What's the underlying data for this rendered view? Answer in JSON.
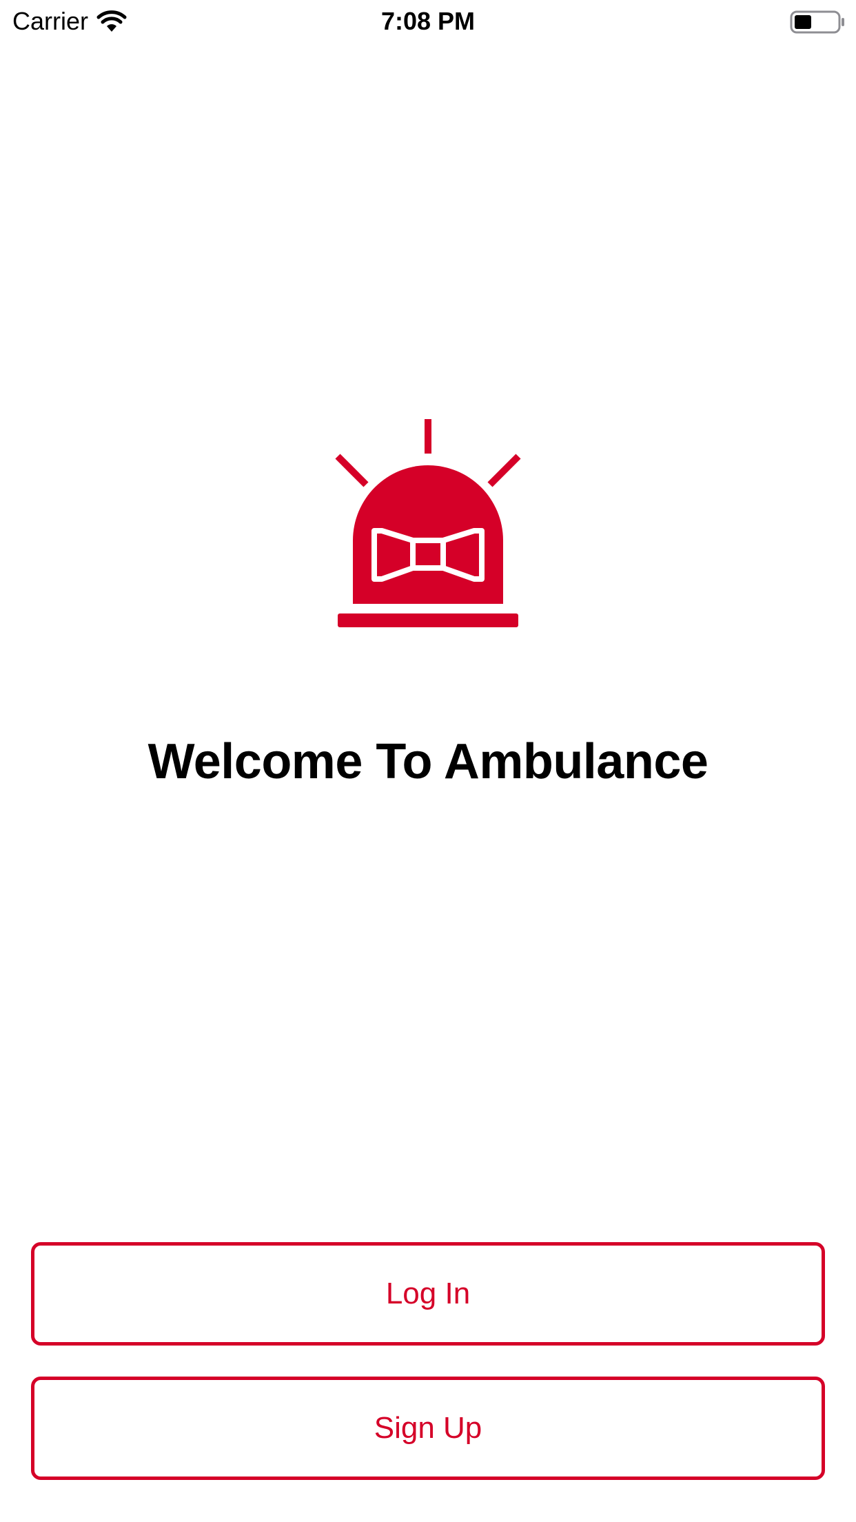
{
  "status_bar": {
    "carrier": "Carrier",
    "time": "7:08 PM",
    "wifi_icon": "wifi-icon",
    "battery_icon": "battery-icon",
    "battery_level": 0.4
  },
  "main": {
    "hero_icon": "siren-icon",
    "title": "Welcome To Ambulance"
  },
  "actions": {
    "login_label": "Log In",
    "signup_label": "Sign Up"
  },
  "colors": {
    "accent": "#d50028",
    "background": "#ffffff",
    "text": "#000000"
  }
}
